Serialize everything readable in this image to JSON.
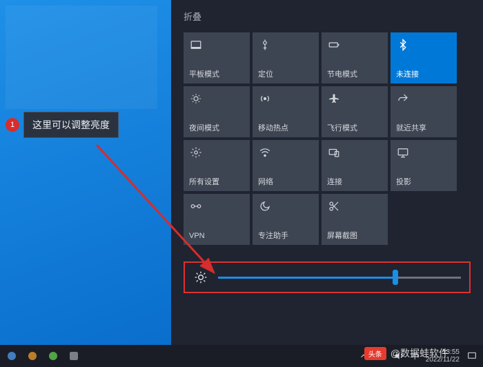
{
  "annotation": {
    "badge": "1",
    "text": "这里可以调整亮度"
  },
  "panel": {
    "collapse": "折叠",
    "tiles": [
      {
        "label": "平板模式",
        "icon": "tablet",
        "active": false
      },
      {
        "label": "定位",
        "icon": "location",
        "active": false
      },
      {
        "label": "节电模式",
        "icon": "battery",
        "active": false
      },
      {
        "label": "未连接",
        "icon": "bluetooth",
        "active": true
      },
      {
        "label": "夜间模式",
        "icon": "night",
        "active": false
      },
      {
        "label": "移动热点",
        "icon": "hotspot",
        "active": false
      },
      {
        "label": "飞行模式",
        "icon": "airplane",
        "active": false
      },
      {
        "label": "就近共享",
        "icon": "share",
        "active": false
      },
      {
        "label": "所有设置",
        "icon": "settings",
        "active": false
      },
      {
        "label": "网络",
        "icon": "wifi",
        "active": false
      },
      {
        "label": "连接",
        "icon": "connect",
        "active": false
      },
      {
        "label": "投影",
        "icon": "project",
        "active": false
      },
      {
        "label": "VPN",
        "icon": "vpn",
        "active": false
      },
      {
        "label": "专注助手",
        "icon": "focus",
        "active": false
      },
      {
        "label": "屏幕截图",
        "icon": "snip",
        "active": false
      }
    ]
  },
  "brightness": {
    "value": 73
  },
  "taskbar": {
    "time": "13:55",
    "date": "2022/11/22"
  },
  "watermark": {
    "brand": "头条",
    "author": "@数据蛙软件"
  }
}
